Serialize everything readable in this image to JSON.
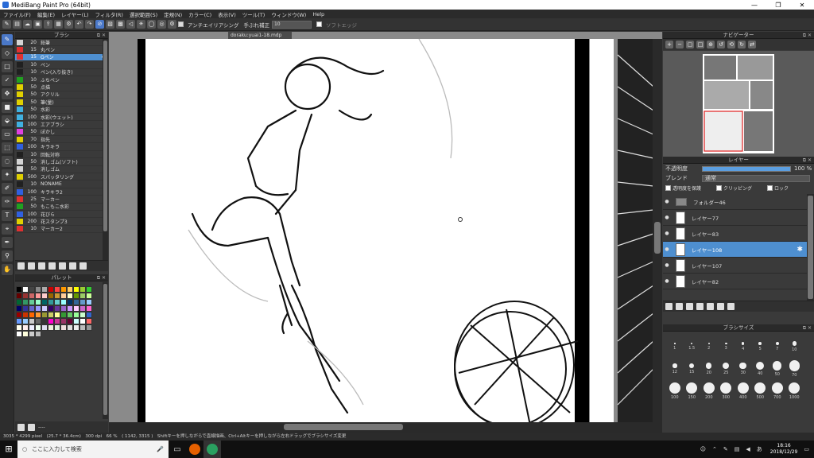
{
  "window": {
    "title": "MediBang Paint Pro (64bit)"
  },
  "menu": [
    "ファイル(F)",
    "編集(E)",
    "レイヤー(L)",
    "フィルタ(R)",
    "選択範囲(S)",
    "定規(N)",
    "カラー(C)",
    "表示(V)",
    "ツール(T)",
    "ウィンドウ(W)",
    "Help"
  ],
  "toolbar": {
    "antialias_label": "アンチエイリアシング",
    "stabilizer_label": "手ぶれ補正",
    "stabilizer_value": "10",
    "softedge_label": "ソフトエッジ"
  },
  "brush_panel": {
    "title": "ブラシ",
    "items": [
      {
        "color": "#d4d4d4",
        "size": "20",
        "name": "鉛筆"
      },
      {
        "color": "#e03030",
        "size": "15",
        "name": "丸ペン"
      },
      {
        "color": "#e03030",
        "size": "15",
        "name": "Gペン",
        "selected": true
      },
      {
        "color": "#202020",
        "size": "10",
        "name": "ペン"
      },
      {
        "color": "#202020",
        "size": "10",
        "name": "ペン(入り抜き)"
      },
      {
        "color": "#20a020",
        "size": "10",
        "name": "ふちペン"
      },
      {
        "color": "#e0d000",
        "size": "50",
        "name": "点描"
      },
      {
        "color": "#e0d000",
        "size": "50",
        "name": "アクリル"
      },
      {
        "color": "#e0d000",
        "size": "50",
        "name": "筆(量)"
      },
      {
        "color": "#40b0e0",
        "size": "50",
        "name": "水彩"
      },
      {
        "color": "#40b0e0",
        "size": "100",
        "name": "水彩(ウェット)"
      },
      {
        "color": "#40b0e0",
        "size": "100",
        "name": "エアブラシ"
      },
      {
        "color": "#e040e0",
        "size": "50",
        "name": "ぼかし"
      },
      {
        "color": "#e0d000",
        "size": "70",
        "name": "指先"
      },
      {
        "color": "#3060e0",
        "size": "100",
        "name": "キラキラ"
      },
      {
        "color": "#202020",
        "size": "10",
        "name": "回転対称"
      },
      {
        "color": "#d4d4d4",
        "size": "50",
        "name": "消しゴム(ソフト)"
      },
      {
        "color": "#d4d4d4",
        "size": "50",
        "name": "消しゴム"
      },
      {
        "color": "#e0d000",
        "size": "500",
        "name": "スパッタリング"
      },
      {
        "color": "#202020",
        "size": "10",
        "name": "NONAME"
      },
      {
        "color": "#3060e0",
        "size": "100",
        "name": "キラキラ2"
      },
      {
        "color": "#e03030",
        "size": "25",
        "name": "マーカー"
      },
      {
        "color": "#20a020",
        "size": "50",
        "name": "もこもこ水彩"
      },
      {
        "color": "#3060e0",
        "size": "100",
        "name": "花びら"
      },
      {
        "color": "#e0d000",
        "size": "200",
        "name": "花スタンプ3"
      },
      {
        "color": "#e03030",
        "size": "10",
        "name": "マーカー2"
      }
    ]
  },
  "palette_panel": {
    "title": "パレット",
    "bottom_text": "----"
  },
  "document": {
    "tab": "doraku:yuai1-18.mdp"
  },
  "navigator": {
    "title": "ナビゲーター"
  },
  "layer_panel": {
    "title": "レイヤー",
    "opacity_label": "不透明度",
    "opacity_value": "100 %",
    "blend_label": "ブレンド",
    "blend_value": "通常",
    "protect_label": "透明度を保護",
    "clipping_label": "クリッピング",
    "lock_label": "ロック",
    "layers": [
      {
        "name": "フォルダー46",
        "type": "folder"
      },
      {
        "name": "レイヤー77"
      },
      {
        "name": "レイヤー83"
      },
      {
        "name": "レイヤー108",
        "selected": true
      },
      {
        "name": "レイヤー107"
      },
      {
        "name": "レイヤー82"
      }
    ]
  },
  "brush_size_panel": {
    "title": "ブラシサイズ",
    "sizes": [
      "1",
      "1.5",
      "2",
      "3",
      "4",
      "5",
      "7",
      "10",
      "12",
      "15",
      "20",
      "25",
      "30",
      "40",
      "50",
      "70",
      "100",
      "150",
      "200",
      "300",
      "400",
      "500",
      "700",
      "1000"
    ]
  },
  "status": {
    "text": "3035 * 4299 pixel　(25.7 * 36.4cm)　300 dpi　66 %　( 1142, 3315 )　Shiftキーを押しながらで直線描画、Ctrl+Altキーを押しながら左右ドラッグでブラシサイズ変更"
  },
  "taskbar": {
    "search_placeholder": "ここに入力して検索",
    "time": "18:16",
    "date": "2018/12/29"
  }
}
